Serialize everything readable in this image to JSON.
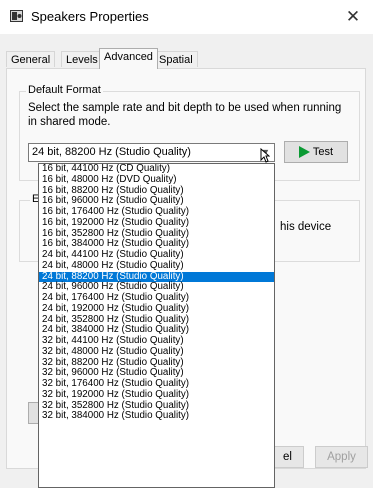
{
  "window": {
    "title": "Speakers Properties",
    "close_glyph": "✕"
  },
  "tabs": [
    {
      "label": "General",
      "active": false
    },
    {
      "label": "Levels",
      "active": false
    },
    {
      "label": "Advanced",
      "active": true
    },
    {
      "label": "Spatial sound",
      "active": false
    }
  ],
  "default_format": {
    "group_label": "Default Format",
    "description": "Select the sample rate and bit depth to be used when running in shared mode.",
    "selected_value": "24 bit, 88200 Hz (Studio Quality)",
    "test_label": "Test"
  },
  "exclusive": {
    "group_label_visible": "E",
    "partial_text": "his device"
  },
  "buttons": {
    "cancel_partial": "el",
    "apply": "Apply"
  },
  "dropdown": {
    "options": [
      "16 bit, 44100 Hz (CD Quality)",
      "16 bit, 48000 Hz (DVD Quality)",
      "16 bit, 88200 Hz (Studio Quality)",
      "16 bit, 96000 Hz (Studio Quality)",
      "16 bit, 176400 Hz (Studio Quality)",
      "16 bit, 192000 Hz (Studio Quality)",
      "16 bit, 352800 Hz (Studio Quality)",
      "16 bit, 384000 Hz (Studio Quality)",
      "24 bit, 44100 Hz (Studio Quality)",
      "24 bit, 48000 Hz (Studio Quality)",
      "24 bit, 88200 Hz (Studio Quality)",
      "24 bit, 96000 Hz (Studio Quality)",
      "24 bit, 176400 Hz (Studio Quality)",
      "24 bit, 192000 Hz (Studio Quality)",
      "24 bit, 352800 Hz (Studio Quality)",
      "24 bit, 384000 Hz (Studio Quality)",
      "32 bit, 44100 Hz (Studio Quality)",
      "32 bit, 48000 Hz (Studio Quality)",
      "32 bit, 88200 Hz (Studio Quality)",
      "32 bit, 96000 Hz (Studio Quality)",
      "32 bit, 176400 Hz (Studio Quality)",
      "32 bit, 192000 Hz (Studio Quality)",
      "32 bit, 352800 Hz (Studio Quality)",
      "32 bit, 384000 Hz (Studio Quality)"
    ],
    "selected_index": 10
  },
  "icons": {
    "window": "speaker-icon",
    "close": "close-icon",
    "play": "play-icon",
    "dropdown_arrow": "chevron-down-icon",
    "cursor": "mouse-cursor-icon"
  },
  "colors": {
    "selection": "#0078d7",
    "play": "#0a9a33"
  }
}
